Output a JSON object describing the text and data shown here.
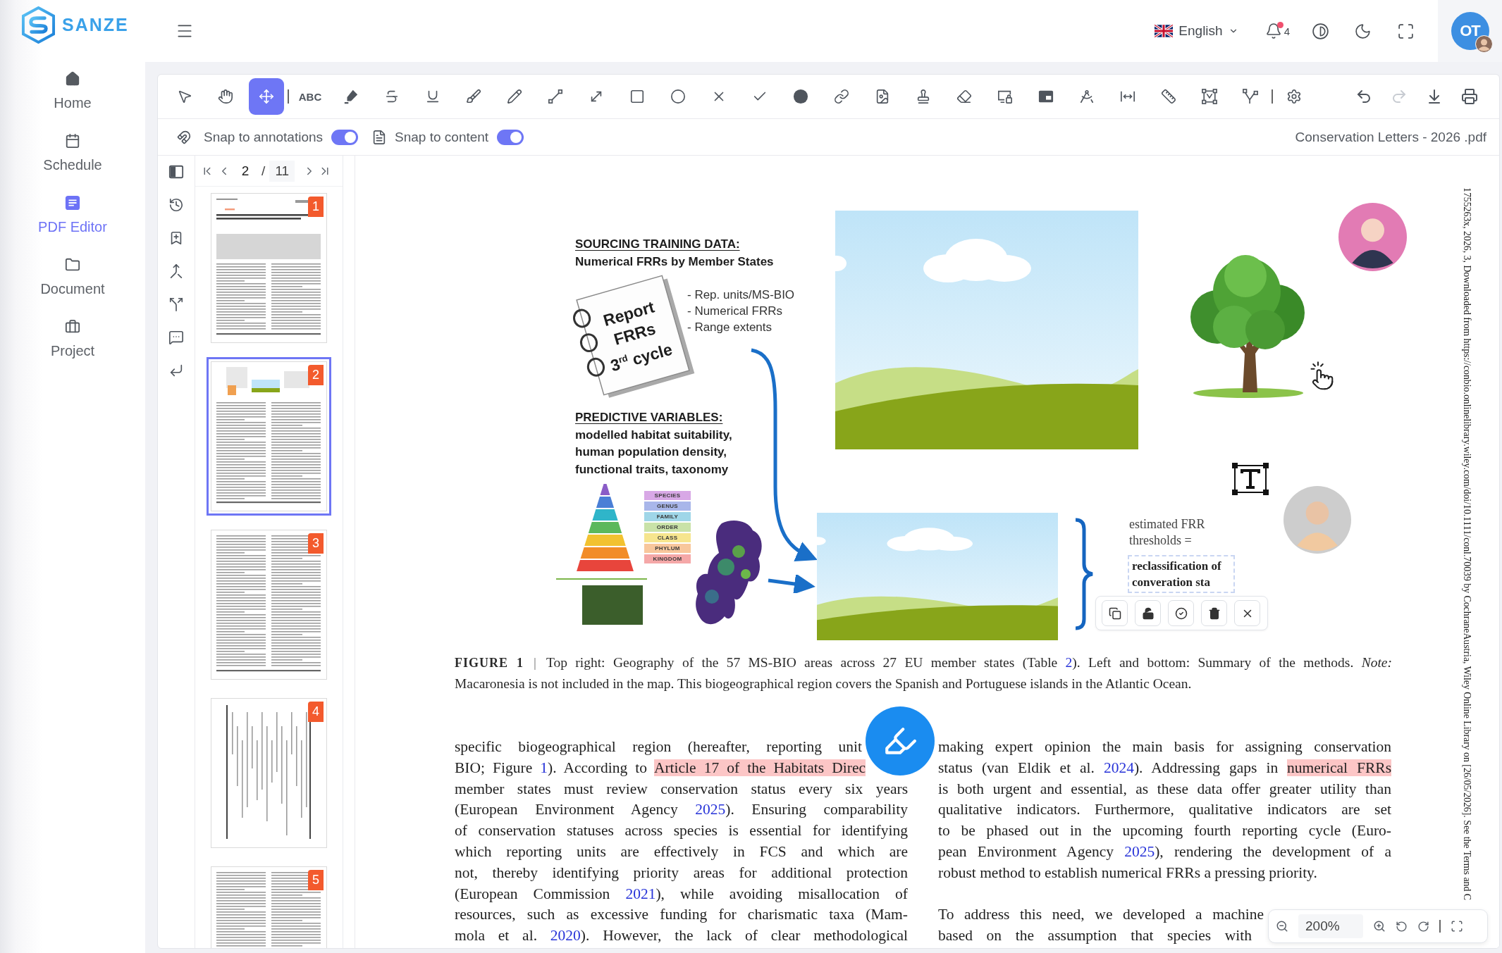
{
  "app": {
    "logo": "SANZE"
  },
  "sidebar": {
    "items": [
      {
        "label": "Home",
        "selected": false
      },
      {
        "label": "Schedule",
        "selected": false
      },
      {
        "label": "PDF Editor",
        "selected": true
      },
      {
        "label": "Document",
        "selected": false
      },
      {
        "label": "Project",
        "selected": false
      }
    ]
  },
  "header": {
    "language": "English",
    "notification_count": "4",
    "avatar_initials": "OT"
  },
  "toolbar": {
    "tools": [
      {
        "selected": false
      },
      {
        "selected": false
      },
      {
        "selected": true
      },
      {
        "label": "ABC",
        "selected": false
      },
      {
        "selected": false
      },
      {
        "selected": false
      },
      {
        "selected": false
      },
      {
        "selected": false
      },
      {
        "selected": false
      },
      {
        "selected": false
      },
      {
        "selected": false
      },
      {
        "selected": false
      },
      {
        "selected": false
      },
      {
        "selected": false
      },
      {
        "selected": false
      },
      {
        "selected": false
      },
      {
        "selected": false
      },
      {
        "selected": false
      },
      {
        "selected": false
      },
      {
        "selected": false
      },
      {
        "selected": false
      },
      {
        "selected": false
      },
      {
        "selected": false
      },
      {
        "selected": false
      },
      {
        "selected": false
      },
      {
        "selected": false
      },
      {
        "selected": false
      },
      {
        "selected": false
      }
    ],
    "actions": [
      {
        "disabled": false
      },
      {
        "disabled": true
      },
      {
        "disabled": false
      },
      {
        "disabled": false
      }
    ]
  },
  "snap_bar": {
    "options": [
      {
        "label": "Snap to annotations",
        "on": true
      },
      {
        "label": "Snap to content",
        "on": true
      }
    ],
    "file_name": "Conservation Letters - 2026 .pdf"
  },
  "page_nav": {
    "current": "2",
    "separator": "/",
    "total": "11"
  },
  "thumbnails": [
    {
      "number": "1",
      "selected": false
    },
    {
      "number": "2",
      "selected": true
    },
    {
      "number": "3",
      "selected": false
    },
    {
      "number": "4",
      "selected": false
    },
    {
      "number": "5",
      "selected": false
    }
  ],
  "figure": {
    "sourcing_heading": "SOURCING TRAINING DATA:",
    "sourcing_subheading": "Numerical FRRs by Member States",
    "notebook": [
      "Report",
      "FRRs",
      "3$^{rd}$ cycle"
    ],
    "sourcing_items": [
      "- Rep. units/MS-BIO",
      "- Numerical FRRs",
      "- Range extents"
    ],
    "predictive_heading": "PREDICTIVE VARIABLES:",
    "predictive_lines": [
      "modelled habitat suitability,",
      "human population density,",
      "functional traits, taxonomy"
    ],
    "taxonomy_ranks": [
      {
        "label": "SPECIES",
        "color": "#d8a8e6"
      },
      {
        "label": "GENUS",
        "color": "#a9b6ea"
      },
      {
        "label": "FAMILY",
        "color": "#9fd6e8"
      },
      {
        "label": "ORDER",
        "color": "#c9e2a8"
      },
      {
        "label": "CLASS",
        "color": "#f6e58e"
      },
      {
        "label": "PHYLUM",
        "color": "#f8c79c"
      },
      {
        "label": "KINGDOM",
        "color": "#f5a8a8"
      }
    ],
    "estimate_label": "estimated FRR thresholds =",
    "annotation_text": "reclassification of converation sta"
  },
  "caption": {
    "label": "FIGURE 1",
    "separator": "|",
    "lines": [
      [
        {
          "kind": "text",
          "text": "Top right: Geography of the 57 MS-BIO areas across 27 EU member states (Table "
        },
        {
          "kind": "link",
          "text": "2"
        },
        {
          "kind": "text",
          "text": "). Left and bottom: Summary of the methods. *Note:*"
        }
      ],
      [
        {
          "kind": "text",
          "text": "Macaronesia is not included in the map. This biogeographical region covers the Spanish and Portuguese islands in the Atlantic Ocean."
        }
      ]
    ]
  },
  "body": {
    "columns": [
      {
        "paragraphs": [
          {
            "lines": [
              [
                {
                  "kind": "text",
                  "text": "specific biogeographical region (hereafter, reporting unit"
                }
              ],
              [
                {
                  "kind": "text",
                  "text": "BIO; Figure "
                },
                {
                  "kind": "link",
                  "text": "1"
                },
                {
                  "kind": "text",
                  "text": "). According to "
                },
                {
                  "kind": "highlight",
                  "text": "Article 17 of the Habitats Direc"
                }
              ],
              [
                {
                  "kind": "text",
                  "text": "member states must review conservation status every six years"
                }
              ],
              [
                {
                  "kind": "text",
                  "text": "(European Environment Agency "
                },
                {
                  "kind": "link",
                  "text": "2025"
                },
                {
                  "kind": "text",
                  "text": "). Ensuring comparability"
                }
              ],
              [
                {
                  "kind": "text",
                  "text": "of conservation statuses across species is essential for identifying"
                }
              ],
              [
                {
                  "kind": "text",
                  "text": "which reporting units are effectively in FCS and which are"
                }
              ],
              [
                {
                  "kind": "text",
                  "text": "not, thereby identifying priority areas for additional protection"
                }
              ],
              [
                {
                  "kind": "text",
                  "text": "(European Commission "
                },
                {
                  "kind": "link",
                  "text": "2021"
                },
                {
                  "kind": "text",
                  "text": "), while avoiding misallocation of"
                }
              ],
              [
                {
                  "kind": "text",
                  "text": "resources, such as excessive funding for charismatic taxa (Mam-"
                }
              ],
              [
                {
                  "kind": "text",
                  "text": "mola et al. "
                },
                {
                  "kind": "link",
                  "text": "2020"
                },
                {
                  "kind": "text",
                  "text": "). However, the lack of clear methodological"
                }
              ]
            ]
          }
        ]
      },
      {
        "paragraphs": [
          {
            "lines": [
              [
                {
                  "kind": "text",
                  "text": "making expert opinion the main basis for assigning conservation"
                }
              ],
              [
                {
                  "kind": "text",
                  "text": "status (van Eldik et al. "
                },
                {
                  "kind": "link",
                  "text": "2024"
                },
                {
                  "kind": "text",
                  "text": "). Addressing gaps in "
                },
                {
                  "kind": "highlight",
                  "text": "numerical FRRs"
                }
              ],
              [
                {
                  "kind": "text",
                  "text": "is both urgent and essential, as these data offer greater utility than"
                }
              ],
              [
                {
                  "kind": "text",
                  "text": "qualitative indicators. Furthermore, qualitative indicators are set"
                }
              ],
              [
                {
                  "kind": "text",
                  "text": "to be phased out in the upcoming fourth reporting cycle (Euro-"
                }
              ],
              [
                {
                  "kind": "text",
                  "text": "pean Environment Agency "
                },
                {
                  "kind": "link",
                  "text": "2025"
                },
                {
                  "kind": "text",
                  "text": "), rendering the development of a"
                }
              ],
              [
                {
                  "kind": "text",
                  "text": "robust method to establish numerical FRRs a pressing priority."
                }
              ]
            ]
          },
          {
            "lines": [
              [
                {
                  "kind": "text",
                  "text": "To address this need, we developed a machine"
                }
              ],
              [
                {
                  "kind": "text",
                  "text": "based on the assumption that species with"
                }
              ]
            ]
          }
        ]
      }
    ]
  },
  "margin_note": "1755263x, 2026, 3, Downloaded from https://conbio.onlinelibrary.wiley.com/doi/10.1111/conl.70039 by CochraneAustria, Wiley Online Library on [26/05/2026]. See the Terms and C",
  "zoom": {
    "value": "200%"
  }
}
